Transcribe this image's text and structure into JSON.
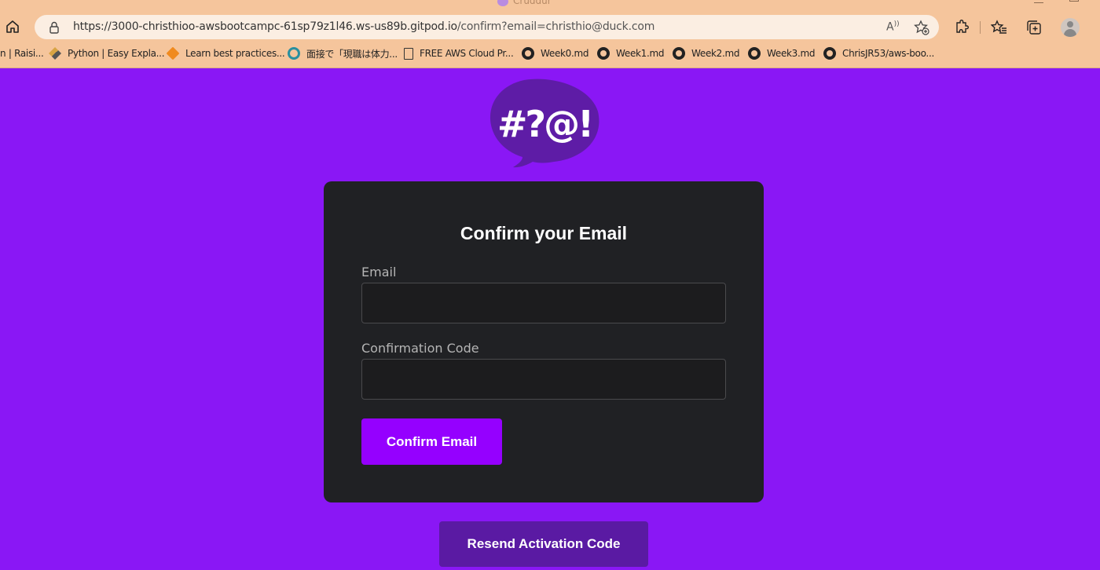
{
  "window": {
    "title": "Cruddur"
  },
  "addressbar": {
    "url_host": "https://3000-christhioo-awsbootcampc-61sp79z1l46.ws-us89b.gitpod.io",
    "url_path": "/confirm?email=christhio@duck.com",
    "read_aloud_label": "Ă"
  },
  "bookmarks": [
    {
      "label": "n | Raisi...",
      "icon": "bookmark-icon"
    },
    {
      "label": "Python | Easy Expla...",
      "icon": "python-icon"
    },
    {
      "label": "Learn best practices...",
      "icon": "aws-cube-icon"
    },
    {
      "label": "面接で「現職は体力...",
      "icon": "site-icon"
    },
    {
      "label": "FREE AWS Cloud Pr...",
      "icon": "document-icon"
    },
    {
      "label": "Week0.md",
      "icon": "github-icon"
    },
    {
      "label": "Week1.md",
      "icon": "github-icon"
    },
    {
      "label": "Week2.md",
      "icon": "github-icon"
    },
    {
      "label": "Week3.md",
      "icon": "github-icon"
    },
    {
      "label": "ChrisJR53/aws-boo...",
      "icon": "github-icon"
    }
  ],
  "logo": {
    "text": "#?@!",
    "icon": "cruddur-speech-bubble-logo"
  },
  "form": {
    "title": "Confirm your Email",
    "email_label": "Email",
    "email_value": "",
    "code_label": "Confirmation Code",
    "code_value": "",
    "submit_label": "Confirm Email"
  },
  "resend": {
    "label": "Resend Activation Code"
  },
  "colors": {
    "page_bg": "#8a17f5",
    "card_bg": "#202124",
    "primary_button": "#9500ff",
    "secondary_button": "#5a1aa3",
    "browser_chrome": "#f5c59c"
  }
}
